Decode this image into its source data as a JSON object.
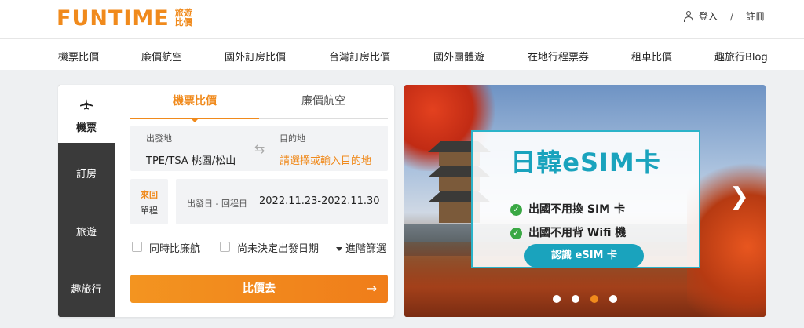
{
  "brand": {
    "logo_text": "FUNTIME",
    "logo_sub_1": "旅遊",
    "logo_sub_2": "比價",
    "color": "#f08a1c"
  },
  "auth": {
    "login": "登入",
    "separator": "/",
    "register": "註冊"
  },
  "nav": {
    "items": [
      "機票比價",
      "廉價航空",
      "國外訂房比價",
      "台灣訂房比價",
      "國外團體遊",
      "在地行程票券",
      "租車比價",
      "趣旅行Blog"
    ]
  },
  "sidebar": {
    "items": [
      "機票",
      "訂房",
      "旅遊",
      "趣旅行"
    ],
    "active": "機票"
  },
  "search": {
    "tabs": [
      "機票比價",
      "廉價航空"
    ],
    "origin_label": "出發地",
    "origin_value": "TPE/TSA 桃園/松山",
    "dest_label": "目的地",
    "dest_placeholder": "請選擇或輸入目的地",
    "trip_round": "來回",
    "trip_oneway": "單程",
    "dates_label": "出發日 - 回程日",
    "dates_value": "2022.11.23-2022.11.30",
    "opt_compare_lcc": "同時比廉航",
    "opt_undecided": "尚未決定出發日期",
    "opt_filter": "進階篩選",
    "submit": "比價去"
  },
  "banner": {
    "title": "日韓eSIM卡",
    "bullet_1": "出國不用換 SIM 卡",
    "bullet_2": "出國不用背 Wifi 機",
    "cta": "認識 eSIM 卡",
    "slide_count": 4,
    "active_slide": 3,
    "accent": "#1aa3bd"
  }
}
